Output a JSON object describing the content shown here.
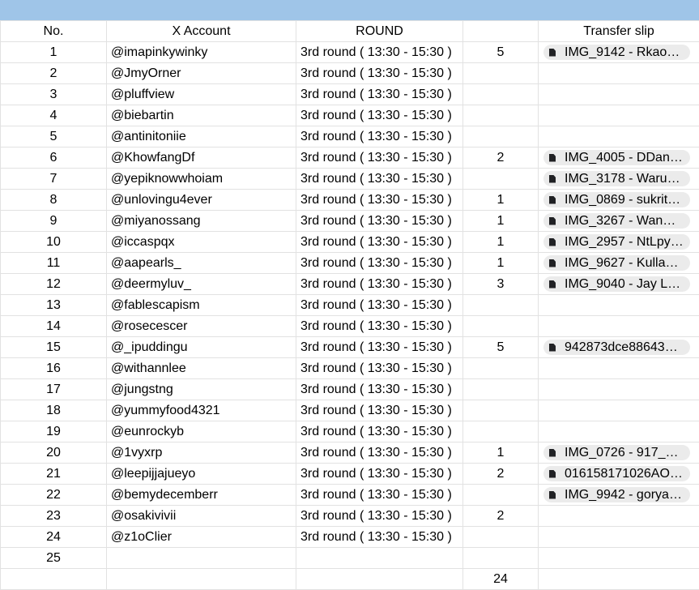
{
  "header": {
    "no": "No.",
    "account": "X Account",
    "round": "ROUND",
    "count": "",
    "slip": "Transfer slip"
  },
  "rows": [
    {
      "no": "1",
      "account": "@imapinkywinky",
      "round": "3rd round ( 13:30 - 15:30 )",
      "count": "5",
      "slip": "IMG_9142 - Rkao…"
    },
    {
      "no": "2",
      "account": "@JmyOrner",
      "round": "3rd round ( 13:30 - 15:30 )",
      "count": "",
      "slip": ""
    },
    {
      "no": "3",
      "account": "@pluffview",
      "round": "3rd round ( 13:30 - 15:30 )",
      "count": "",
      "slip": ""
    },
    {
      "no": "4",
      "account": "@biebartin",
      "round": "3rd round ( 13:30 - 15:30 )",
      "count": "",
      "slip": ""
    },
    {
      "no": "5",
      "account": "@antinitoniie",
      "round": "3rd round ( 13:30 - 15:30 )",
      "count": "",
      "slip": ""
    },
    {
      "no": "6",
      "account": "@KhowfangDf",
      "round": "3rd round ( 13:30 - 15:30 )",
      "count": "2",
      "slip": "IMG_4005 - DDan…"
    },
    {
      "no": "7",
      "account": "@yepiknowwhoiam",
      "round": "3rd round ( 13:30 - 15:30 )",
      "count": "",
      "slip": "IMG_3178 - Waru…"
    },
    {
      "no": "8",
      "account": "@unlovingu4ever",
      "round": "3rd round ( 13:30 - 15:30 )",
      "count": "1",
      "slip": "IMG_0869 - sukritt…"
    },
    {
      "no": "9",
      "account": "@miyanossang",
      "round": "3rd round ( 13:30 - 15:30 )",
      "count": "1",
      "slip": "IMG_3267 - Wanw…"
    },
    {
      "no": "10",
      "account": "@iccaspqx",
      "round": "3rd round ( 13:30 - 15:30 )",
      "count": "1",
      "slip": "IMG_2957 - NtLpy…"
    },
    {
      "no": "11",
      "account": "@aapearls_",
      "round": "3rd round ( 13:30 - 15:30 )",
      "count": "1",
      "slip": "IMG_9627 - Kulla…"
    },
    {
      "no": "12",
      "account": "@deermyluv_",
      "round": "3rd round ( 13:30 - 15:30 )",
      "count": "3",
      "slip": "IMG_9040 - Jay L…"
    },
    {
      "no": "13",
      "account": "@fablescapism",
      "round": "3rd round ( 13:30 - 15:30 )",
      "count": "",
      "slip": ""
    },
    {
      "no": "14",
      "account": "@rosecescer",
      "round": "3rd round ( 13:30 - 15:30 )",
      "count": "",
      "slip": ""
    },
    {
      "no": "15",
      "account": "@_ipuddingu",
      "round": "3rd round ( 13:30 - 15:30 )",
      "count": "5",
      "slip": "942873dce886436…"
    },
    {
      "no": "16",
      "account": "@withannlee",
      "round": "3rd round ( 13:30 - 15:30 )",
      "count": "",
      "slip": ""
    },
    {
      "no": "17",
      "account": "@jungstng",
      "round": "3rd round ( 13:30 - 15:30 )",
      "count": "",
      "slip": ""
    },
    {
      "no": "18",
      "account": "@yummyfood4321",
      "round": "3rd round ( 13:30 - 15:30 )",
      "count": "",
      "slip": ""
    },
    {
      "no": "19",
      "account": "@eunrockyb",
      "round": "3rd round ( 13:30 - 15:30 )",
      "count": "",
      "slip": ""
    },
    {
      "no": "20",
      "account": "@1vyxrp",
      "round": "3rd round ( 13:30 - 15:30 )",
      "count": "1",
      "slip": "IMG_0726 - 917_…"
    },
    {
      "no": "21",
      "account": "@leepijjajueyo",
      "round": "3rd round ( 13:30 - 15:30 )",
      "count": "2",
      "slip": "016158171026AO…"
    },
    {
      "no": "22",
      "account": "@bemydecemberr",
      "round": "3rd round ( 13:30 - 15:30 )",
      "count": "",
      "slip": "IMG_9942 - gorya…"
    },
    {
      "no": "23",
      "account": "@osakivivii",
      "round": "3rd round ( 13:30 - 15:30 )",
      "count": "2",
      "slip": ""
    },
    {
      "no": "24",
      "account": "@z1oClier",
      "round": "3rd round ( 13:30 - 15:30 )",
      "count": "",
      "slip": ""
    },
    {
      "no": "25",
      "account": "",
      "round": "",
      "count": "",
      "slip": ""
    }
  ],
  "footer": {
    "total": "24"
  },
  "icons": {
    "slip_chip": "file-icon"
  },
  "colors": {
    "header_band": "#9fc5e8",
    "chip_bg": "#ebebeb",
    "grid_line": "#e2e2e2"
  }
}
